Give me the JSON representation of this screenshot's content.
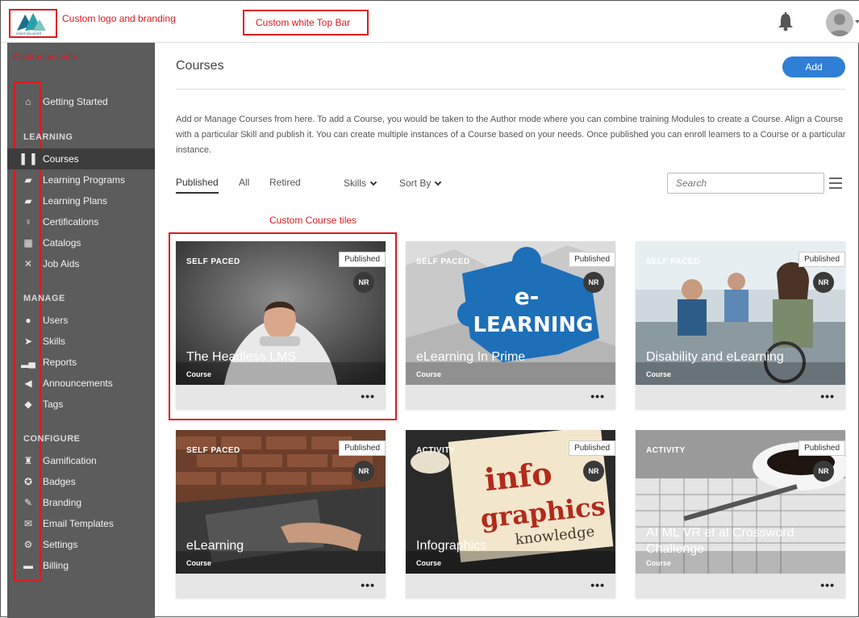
{
  "annotations": {
    "logo": "Custom logo and branding",
    "topbar": "Custom white Top Bar",
    "sidebar": "Custom accents",
    "tiles": "Custom Course tiles"
  },
  "header": {
    "logo_text": "elearning world"
  },
  "sidebar": {
    "items": [
      {
        "label": "Getting Started",
        "icon": "home-icon"
      },
      {
        "label": "Courses",
        "icon": "book-icon",
        "active": true
      },
      {
        "label": "Learning Programs",
        "icon": "learning-programs-icon"
      },
      {
        "label": "Learning Plans",
        "icon": "learning-plans-icon"
      },
      {
        "label": "Certifications",
        "icon": "certificate-icon"
      },
      {
        "label": "Catalogs",
        "icon": "grid-icon"
      },
      {
        "label": "Job Aids",
        "icon": "pin-icon"
      },
      {
        "label": "Users",
        "icon": "users-icon"
      },
      {
        "label": "Skills",
        "icon": "skills-icon"
      },
      {
        "label": "Reports",
        "icon": "bar-chart-icon"
      },
      {
        "label": "Announcements",
        "icon": "megaphone-icon"
      },
      {
        "label": "Tags",
        "icon": "tag-icon"
      },
      {
        "label": "Gamification",
        "icon": "trophy-icon"
      },
      {
        "label": "Badges",
        "icon": "badge-icon"
      },
      {
        "label": "Branding",
        "icon": "brush-icon"
      },
      {
        "label": "Email Templates",
        "icon": "email-icon"
      },
      {
        "label": "Settings",
        "icon": "gear-icon"
      },
      {
        "label": "Billing",
        "icon": "billing-icon"
      }
    ],
    "sections": [
      "LEARNING",
      "MANAGE",
      "CONFIGURE"
    ]
  },
  "main": {
    "title": "Courses",
    "add_label": "Add",
    "description": "Add or Manage Courses from here. To add a Course, you would be taken to the Author mode where you can combine training Modules to create a Course. Align a Course with a particular Skill and publish it. You can create multiple instances of a Course based on your needs. Once published you can enroll learners to a Course or a particular instance.",
    "tabs": [
      "Published",
      "All",
      "Retired"
    ],
    "skills_label": "Skills",
    "sort_label": "Sort By",
    "search_placeholder": "Search"
  },
  "cards": [
    {
      "type": "SELF PACED",
      "status": "Published",
      "badge": "NR",
      "title": "The Headless LMS",
      "subtitle": "Course",
      "more": "•••"
    },
    {
      "type": "SELF PACED",
      "status": "Published",
      "badge": "NR",
      "title": "eLearning In Prime",
      "subtitle": "Course",
      "more": "•••"
    },
    {
      "type": "SELF PACED",
      "status": "Published",
      "badge": "NR",
      "title": "Disability and eLearning",
      "subtitle": "Course",
      "more": "•••"
    },
    {
      "type": "SELF PACED",
      "status": "Published",
      "badge": "NR",
      "title": "eLearning",
      "subtitle": "Course",
      "more": "•••"
    },
    {
      "type": "ACTIVITY",
      "status": "Published",
      "badge": "NR",
      "title": "Infographics",
      "subtitle": "Course",
      "more": "•••"
    },
    {
      "type": "ACTIVITY",
      "status": "Published",
      "badge": "NR",
      "title": "AI ML VR et al Crossword Challenge",
      "subtitle": "Course",
      "more": "•••"
    }
  ],
  "card_images": {
    "elearning_word": "LEARNING",
    "elearning_e": "e-",
    "info_word_1": "info",
    "info_word_2": "graphics",
    "info_word_3": "knowledge"
  },
  "colors": {
    "sidebar_bg": "#5c5c5c",
    "sidebar_active": "#3d3d3d",
    "accent": "#2f7fd7",
    "annotation": "#e0191e"
  }
}
